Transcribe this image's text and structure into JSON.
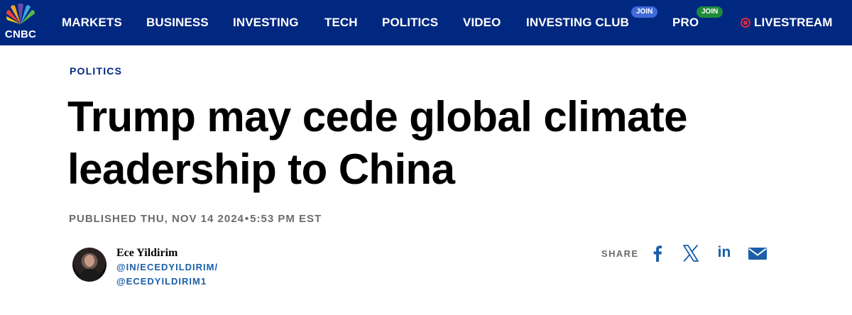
{
  "nav": {
    "logo_text": "CNBC",
    "items": [
      {
        "label": "MARKETS"
      },
      {
        "label": "BUSINESS"
      },
      {
        "label": "INVESTING"
      },
      {
        "label": "TECH"
      },
      {
        "label": "POLITICS"
      },
      {
        "label": "VIDEO"
      },
      {
        "label": "INVESTING CLUB",
        "badge": "JOIN"
      },
      {
        "label": "PRO",
        "badge": "JOIN"
      },
      {
        "label": "LIVESTREAM"
      }
    ],
    "colors": {
      "background": "#002880",
      "investing_club_badge": "#3f6ad8",
      "pro_badge": "#1f8a3c",
      "live_indicator": "#e0283b"
    }
  },
  "article": {
    "section": "POLITICS",
    "headline_line1": "Trump may cede global climate",
    "headline_line2": "leadership to China",
    "published_prefix": "PUBLISHED THU, NOV 14 2024",
    "published_separator": "•",
    "published_time": "5:53 PM EST"
  },
  "author": {
    "name": "Ece Yildirim",
    "linkedin": "@IN/ECEDYILDIRIM/",
    "twitter": "@ECEDYILDIRIM1"
  },
  "share": {
    "label": "SHARE",
    "linkedin_text": "in",
    "icons": [
      "facebook-icon",
      "x-icon",
      "linkedin-icon",
      "mail-icon"
    ],
    "icon_color": "#1a5fa8"
  }
}
